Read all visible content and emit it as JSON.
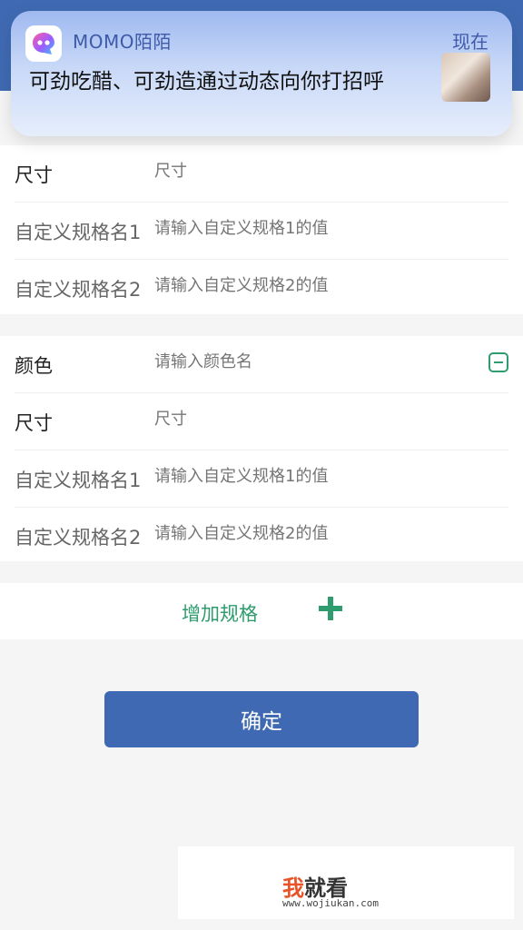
{
  "notification": {
    "app_name": "MOMO陌陌",
    "time": "现在",
    "message": "可劲吃醋、可劲造通过动态向你打招呼",
    "icon": "momo-app-icon"
  },
  "spec_group_1": {
    "rows": [
      {
        "label": "尺寸",
        "placeholder": "尺寸"
      },
      {
        "label": "自定义规格名1",
        "placeholder": "请输入自定义规格1的值"
      },
      {
        "label": "自定义规格名2",
        "placeholder": "请输入自定义规格2的值"
      }
    ]
  },
  "spec_group_2": {
    "rows": [
      {
        "label": "颜色",
        "placeholder": "请输入颜色名"
      },
      {
        "label": "尺寸",
        "placeholder": "尺寸"
      },
      {
        "label": "自定义规格名1",
        "placeholder": "请输入自定义规格1的值"
      },
      {
        "label": "自定义规格名2",
        "placeholder": "请输入自定义规格2的值"
      }
    ],
    "remove_icon": "minus-square-icon"
  },
  "add_spec": {
    "label": "增加规格",
    "icon": "plus-icon"
  },
  "confirm_button": {
    "label": "确定"
  },
  "watermark": {
    "title_first": "我",
    "title_rest": "就看",
    "url": "www.wojiukan.com"
  },
  "colors": {
    "primary": "#3f6ab3",
    "accent_green": "#2e9c6e"
  }
}
